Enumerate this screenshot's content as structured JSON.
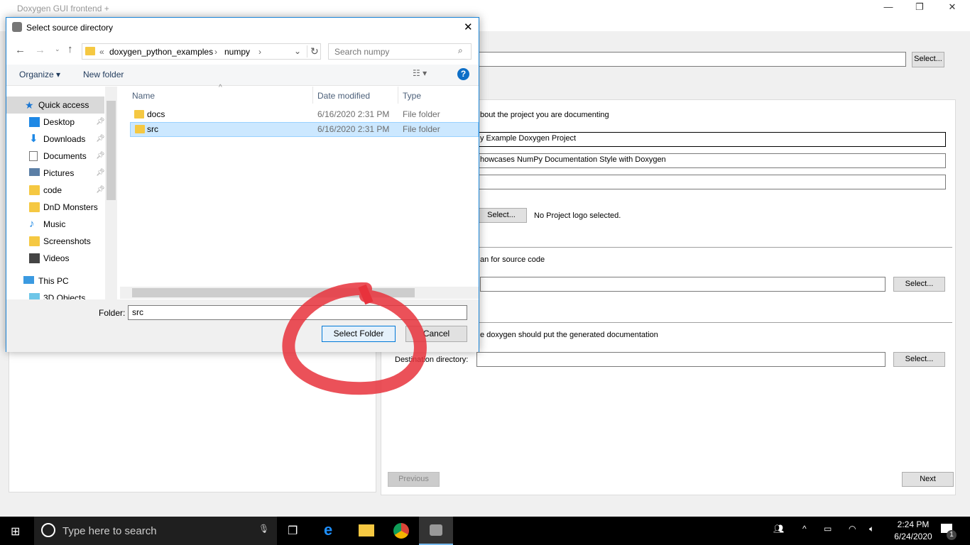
{
  "app": {
    "title": "Doxygen GUI frontend +",
    "minimize": "—",
    "maximize": "❐",
    "close": "✕",
    "workdir_select": "Select...",
    "project_intro": "bout the project you are documenting",
    "project_name": "y Example Doxygen Project",
    "project_synopsis": "howcases NumPy Documentation Style with Doxygen",
    "project_version": "",
    "logo_select": "Select...",
    "logo_status": "No Project logo selected.",
    "source_intro": "an for source code",
    "source_select": "Select...",
    "dest_intro": "e doxygen should put the generated documentation",
    "dest_label": "Destination directory:",
    "dest_select": "Select...",
    "previous": "Previous",
    "next": "Next"
  },
  "dialog": {
    "title": "Select source directory",
    "close": "✕",
    "breadcrumb": [
      "doxygen_python_examples",
      "numpy"
    ],
    "search_placeholder": "Search numpy",
    "organize": "Organize ▾",
    "new_folder": "New folder",
    "nav": [
      {
        "label": "Quick access",
        "icon": "star-icon"
      },
      {
        "label": "Desktop",
        "icon": "desktop-icon",
        "pinned": true
      },
      {
        "label": "Downloads",
        "icon": "download-icon",
        "pinned": true
      },
      {
        "label": "Documents",
        "icon": "documents-icon",
        "pinned": true
      },
      {
        "label": "Pictures",
        "icon": "pictures-icon",
        "pinned": true
      },
      {
        "label": "code",
        "icon": "folder-icon",
        "pinned": true
      },
      {
        "label": "DnD Monsters",
        "icon": "folder-icon"
      },
      {
        "label": "Music",
        "icon": "music-icon"
      },
      {
        "label": "Screenshots",
        "icon": "folder-icon"
      },
      {
        "label": "Videos",
        "icon": "videos-icon"
      },
      {
        "label": "This PC",
        "icon": "pc-icon"
      },
      {
        "label": "3D Objects",
        "icon": "3d-icon"
      }
    ],
    "columns": [
      "Name",
      "Date modified",
      "Type"
    ],
    "files": [
      {
        "name": "docs",
        "date": "6/16/2020 2:31 PM",
        "type": "File folder"
      },
      {
        "name": "src",
        "date": "6/16/2020 2:31 PM",
        "type": "File folder",
        "selected": true
      }
    ],
    "folder_label": "Folder:",
    "folder_value": "src",
    "select_folder": "Select Folder",
    "cancel": "Cancel"
  },
  "annotation_color": "#e8323c",
  "taskbar": {
    "search_placeholder": "Type here to search",
    "time": "2:24 PM",
    "date": "6/24/2020",
    "notifications": "1"
  }
}
